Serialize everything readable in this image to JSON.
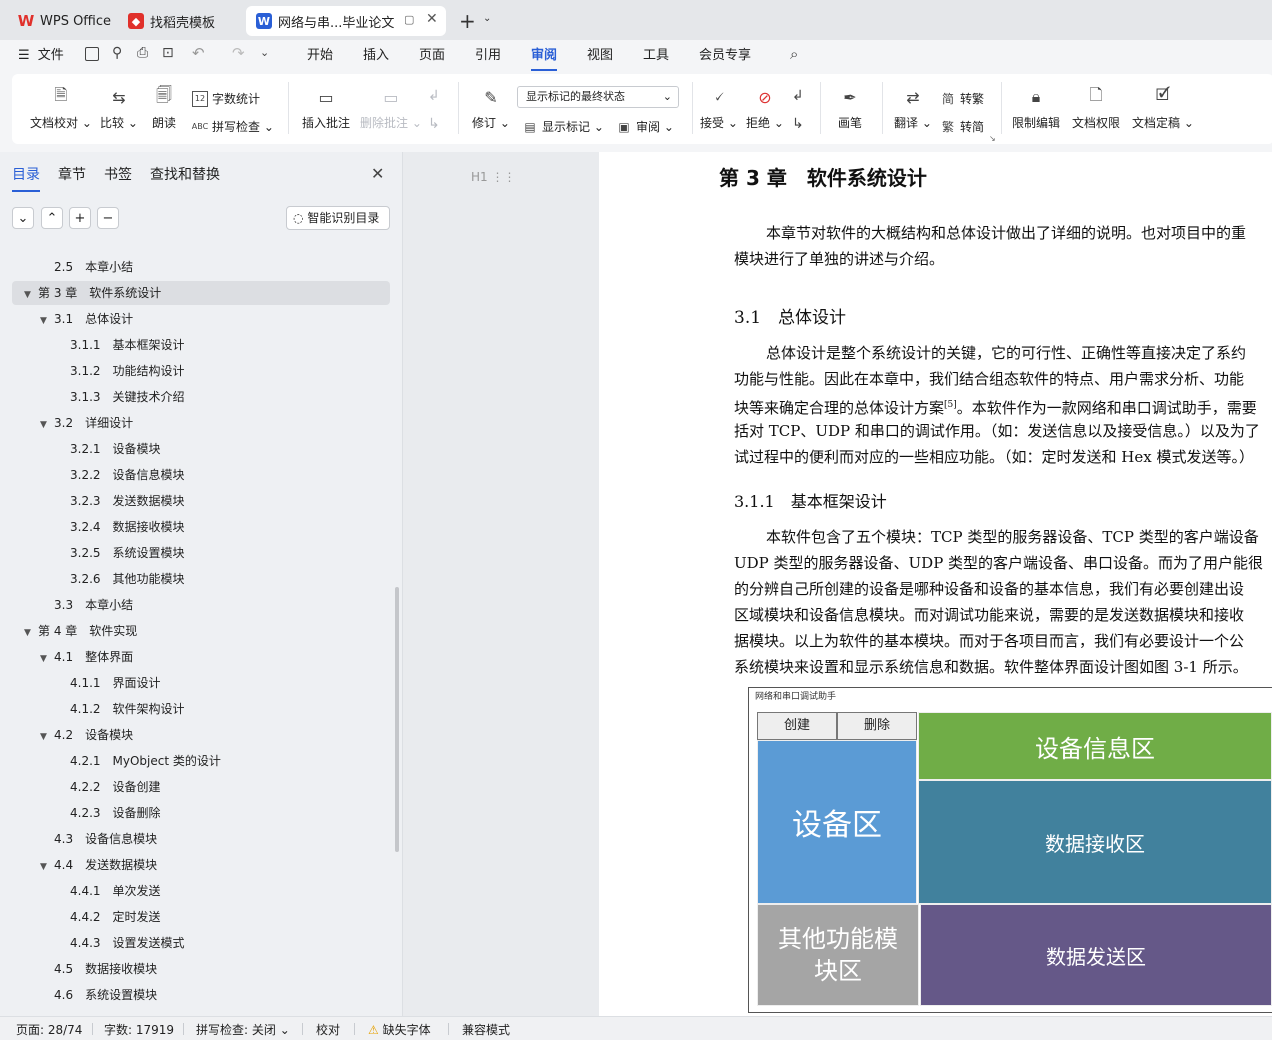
{
  "tabs": [
    {
      "label": "WPS Office",
      "icon": "wps-logo-icon"
    },
    {
      "label": "找稻壳模板",
      "icon": "docer-icon"
    },
    {
      "label": "网络与串...毕业论文",
      "icon": "word-doc-icon"
    }
  ],
  "menu": {
    "file": "文件",
    "items": [
      "开始",
      "插入",
      "页面",
      "引用",
      "审阅",
      "视图",
      "工具",
      "会员专享"
    ]
  },
  "ribbon": {
    "doc_check": "文档校对",
    "compare": "比较",
    "read_aloud": "朗读",
    "word_count": "字数统计",
    "spell_check": "拼写检查",
    "insert_comment": "插入批注",
    "delete_comment": "删除批注",
    "revise": "修订",
    "markup_state": "显示标记的最终状态",
    "show_markup": "显示标记",
    "review": "审阅",
    "accept": "接受",
    "reject": "拒绝",
    "pen": "画笔",
    "translate": "翻译",
    "to_traditional": "转繁",
    "to_simplified": "转简",
    "restrict_edit": "限制编辑",
    "doc_permission": "文档权限",
    "doc_finalize": "文档定稿"
  },
  "panel": {
    "tabs": [
      "目录",
      "章节",
      "书签",
      "查找和替换"
    ],
    "smart_toc": "智能识别目录",
    "toc": [
      {
        "text": "2.5　本章小结",
        "level": 2
      },
      {
        "text": "第 3 章　软件系统设计",
        "level": 1,
        "expanded": true,
        "selected": true
      },
      {
        "text": "3.1　总体设计",
        "level": 2,
        "expanded": true
      },
      {
        "text": "3.1.1　基本框架设计",
        "level": 3
      },
      {
        "text": "3.1.2　功能结构设计",
        "level": 3
      },
      {
        "text": "3.1.3　关键技术介绍",
        "level": 3
      },
      {
        "text": "3.2　详细设计",
        "level": 2,
        "expanded": true
      },
      {
        "text": "3.2.1　设备模块",
        "level": 3
      },
      {
        "text": "3.2.2　设备信息模块",
        "level": 3
      },
      {
        "text": "3.2.3　发送数据模块",
        "level": 3
      },
      {
        "text": "3.2.4　数据接收模块",
        "level": 3
      },
      {
        "text": "3.2.5　系统设置模块",
        "level": 3
      },
      {
        "text": "3.2.6　其他功能模块",
        "level": 3
      },
      {
        "text": "3.3　本章小结",
        "level": 2
      },
      {
        "text": "第 4 章　软件实现",
        "level": 1,
        "expanded": true
      },
      {
        "text": "4.1　整体界面",
        "level": 2,
        "expanded": true
      },
      {
        "text": "4.1.1　界面设计",
        "level": 3
      },
      {
        "text": "4.1.2　软件架构设计",
        "level": 3
      },
      {
        "text": "4.2　设备模块",
        "level": 2,
        "expanded": true
      },
      {
        "text": "4.2.1　MyObject 类的设计",
        "level": 3
      },
      {
        "text": "4.2.2　设备创建",
        "level": 3
      },
      {
        "text": "4.2.3　设备删除",
        "level": 3
      },
      {
        "text": "4.3　设备信息模块",
        "level": 2
      },
      {
        "text": "4.4　发送数据模块",
        "level": 2,
        "expanded": true
      },
      {
        "text": "4.4.1　单次发送",
        "level": 3
      },
      {
        "text": "4.4.2　定时发送",
        "level": 3
      },
      {
        "text": "4.4.3　设置发送模式",
        "level": 3
      },
      {
        "text": "4.5　数据接收模块",
        "level": 2
      },
      {
        "text": "4.6　系统设置模块",
        "level": 2
      }
    ]
  },
  "doc": {
    "heading_marker": "H1",
    "chapter_title": "第 3 章　软件系统设计",
    "p1": [
      "本章节对软件的大概结构和总体设计做出了详细的说明。也对项目中的重",
      "模块进行了单独的讲述与介绍。"
    ],
    "h31": "3.1　总体设计",
    "p2": [
      "总体设计是整个系统设计的关键，它的可行性、正确性等直接决定了系约",
      "功能与性能。因此在本章中，我们结合组态软件的特点、用户需求分析、功能",
      "块等来确定合理的总体设计方案",
      "括对 TCP、UDP 和串口的调试作用。（如：发送信息以及接受信息。）以及为了",
      "试过程中的便利而对应的一些相应功能。（如：定时发送和 Hex 模式发送等。）"
    ],
    "p2_ref": "[5]",
    "p2_line3_tail": "。本软件作为一款网络和串口调试助手，需要",
    "h311": "3.1.1　基本框架设计",
    "p3": [
      "本软件包含了五个模块：TCP 类型的服务器设备、TCP 类型的客户端设备",
      "UDP 类型的服务器设备、UDP 类型的客户端设备、串口设备。而为了用户能很",
      "的分辨自己所创建的设备是哪种设备和设备的基本信息，我们有必要创建出设",
      "区域模块和设备信息模块。而对调试功能来说，需要的是发送数据模块和接收",
      "据模块。以上为软件的基本模块。而对于各项目而言，我们有必要设计一个公",
      "系统模块来设置和显示系统信息和数据。软件整体界面设计图如图 3-1 所示。"
    ],
    "figure": {
      "window_title": "网络和串口调试助手",
      "create": "创建",
      "delete": "删除",
      "device_area": "设备区",
      "device_info_area": "设备信息区",
      "receive_area": "数据接收区",
      "other_area": "其他功能模块区",
      "send_area": "数据发送区",
      "colors": {
        "device": "#5b9bd5",
        "info": "#70ad47",
        "receive": "#41819d",
        "other": "#a5a5a5",
        "send": "#655888"
      }
    }
  },
  "status": {
    "page": "页面: 28/74",
    "words": "字数: 17919",
    "spell": "拼写检查: 关闭",
    "proof": "校对",
    "missing_font": "缺失字体",
    "compat": "兼容模式"
  }
}
